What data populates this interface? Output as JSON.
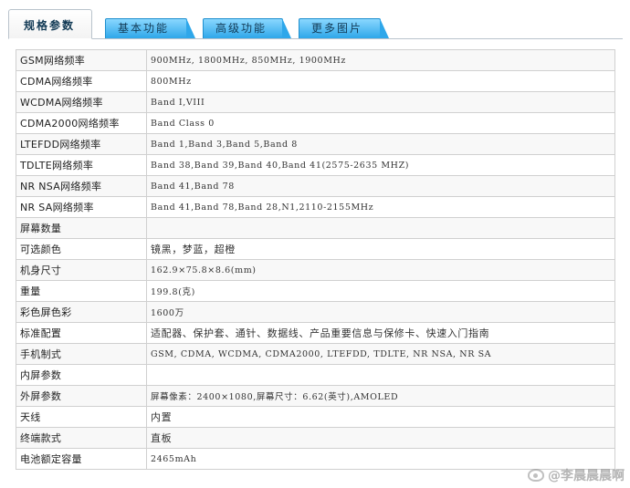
{
  "tabs": [
    {
      "label": "规格参数",
      "active": true
    },
    {
      "label": "基本功能",
      "active": false
    },
    {
      "label": "高级功能",
      "active": false
    },
    {
      "label": "更多图片",
      "active": false
    }
  ],
  "specs": [
    {
      "key": "GSM网络频率",
      "value": "900MHz, 1800MHz, 850MHz, 1900MHz"
    },
    {
      "key": "CDMA网络频率",
      "value": "800MHz"
    },
    {
      "key": "WCDMA网络频率",
      "value": "Band Ⅰ,VIII"
    },
    {
      "key": "CDMA2000网络频率",
      "value": "Band Class 0"
    },
    {
      "key": "LTEFDD网络频率",
      "value": "Band 1,Band 3,Band 5,Band 8"
    },
    {
      "key": "TDLTE网络频率",
      "value": "Band 38,Band 39,Band 40,Band 41(2575-2635 MHZ)"
    },
    {
      "key": "NR NSA网络频率",
      "value": "Band 41,Band 78"
    },
    {
      "key": "NR SA网络频率",
      "value": "Band 41,Band 78,Band 28,N1,2110-2155MHz"
    },
    {
      "key": "屏幕数量",
      "value": ""
    },
    {
      "key": "可选颜色",
      "value": "镜黑，梦蓝，超橙"
    },
    {
      "key": "机身尺寸",
      "value": "162.9×75.8×8.6(mm)"
    },
    {
      "key": "重量",
      "value": "199.8(克)"
    },
    {
      "key": "彩色屏色彩",
      "value": "1600万"
    },
    {
      "key": "标准配置",
      "value": "适配器、保护套、通针、数据线、产品重要信息与保修卡、快速入门指南"
    },
    {
      "key": "手机制式",
      "value": "GSM, CDMA, WCDMA, CDMA2000, LTEFDD, TDLTE, NR NSA, NR SA"
    },
    {
      "key": "内屏参数",
      "value": ""
    },
    {
      "key": "外屏参数",
      "value": "屏幕像素：2400×1080,屏幕尺寸：6.62(英寸),AMOLED"
    },
    {
      "key": "天线",
      "value": "内置"
    },
    {
      "key": "终端款式",
      "value": "直板"
    },
    {
      "key": "电池额定容量",
      "value": "2465mAh"
    }
  ],
  "watermark": "@李晨晨晨啊",
  "colors": {
    "tab_gradient_top": "#8ad7ff",
    "tab_gradient_bottom": "#2ea7ea",
    "border": "#d0d0d0"
  }
}
